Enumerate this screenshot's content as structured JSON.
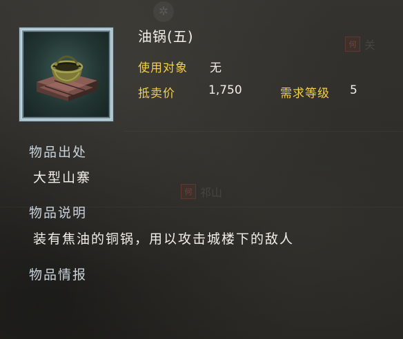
{
  "item": {
    "name": "油锅(五)",
    "icon": "oil-cauldron-icon"
  },
  "attributes": {
    "target_label": "使用对象",
    "target_value": "无",
    "price_label": "抵卖价",
    "price_value": "1,750",
    "level_label": "需求等级",
    "level_value": "5"
  },
  "sections": {
    "source_title": "物品出处",
    "source_text": "大型山寨",
    "description_title": "物品说明",
    "description_text": "装有焦油的铜锅，用以攻击城楼下的敌人",
    "info_title": "物品情报"
  },
  "background": {
    "seal_char": "何",
    "label_top_right": "关",
    "label_middle": "祁山"
  },
  "colors": {
    "label_gold": "#f5cf45",
    "title_steel": "#c8d3dc",
    "text_white": "#f1efe8",
    "frame_cyan": "#a9c2cc"
  }
}
